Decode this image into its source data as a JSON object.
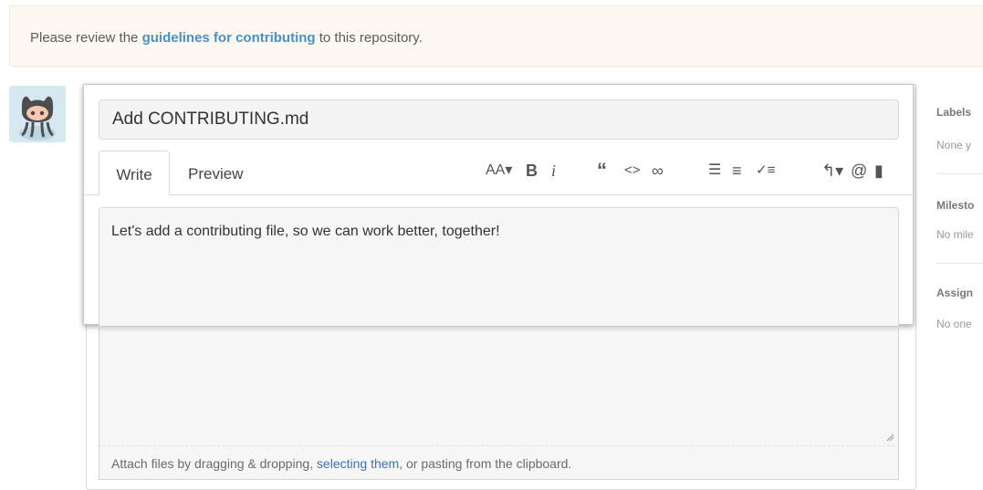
{
  "flash": {
    "before": "Please review the ",
    "link": "guidelines for contributing",
    "after": " to this repository."
  },
  "issue": {
    "title_value": "Add CONTRIBUTING.md",
    "tabs": [
      {
        "label": "Write",
        "active": true
      },
      {
        "label": "Preview",
        "active": false
      }
    ],
    "body_value": "Let's add a contributing file, so we can work better, together!"
  },
  "toolbar": {
    "header_glyph": "AA▾",
    "bold_glyph": "B",
    "italic_glyph": "i",
    "quote_glyph": "“",
    "code_glyph": "<>",
    "link_glyph": "∞",
    "ul_glyph": "☰",
    "ol_glyph": "≡",
    "task_glyph": "✓≡",
    "reply_glyph": "↰▾",
    "mention_glyph": "@",
    "bookmark_glyph": "▮"
  },
  "attach": {
    "before": "Attach files by dragging & dropping, ",
    "link": "selecting them",
    "after": ", or pasting from the clipboard."
  },
  "sidebar": {
    "labels_heading": "Labels",
    "labels_value": "None y",
    "milestone_heading": "Milesto",
    "milestone_value": "No mile",
    "assignees_heading": "Assign",
    "assignees_value": "No one"
  },
  "colors": {
    "link": "#4a90c7",
    "flash_bg": "#fdf8f0"
  }
}
